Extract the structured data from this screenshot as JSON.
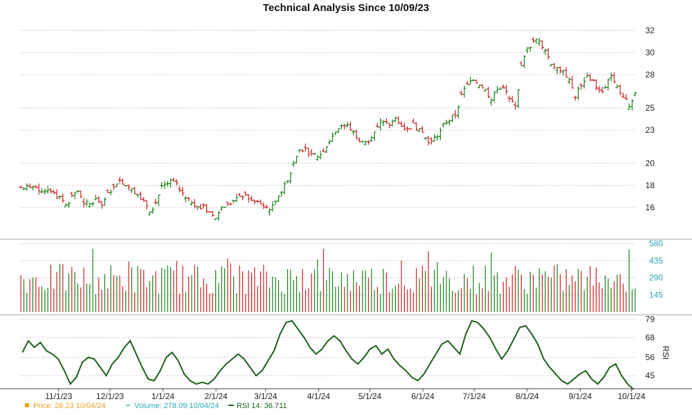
{
  "chart_data": {
    "type": "ohlc",
    "title": "Technical Analysis Since 10/09/23",
    "x_dates": [
      "2023-10-09",
      "2024-10-04"
    ],
    "x_tick_labels": [
      "11/1/23",
      "12/1/23",
      "1/1/24",
      "2/1/24",
      "3/1/24",
      "4/1/24",
      "5/1/24",
      "6/1/24",
      "7/1/24",
      "8/1/24",
      "9/1/24",
      "10/1/24"
    ],
    "price_panel": {
      "ylim": [
        13.5,
        33
      ],
      "ytick_labels": [
        "16",
        "18",
        "20",
        "23",
        "25",
        "28",
        "30",
        "32"
      ],
      "ytick_values": [
        16,
        18,
        20,
        23,
        25,
        28,
        30,
        32
      ],
      "colors": {
        "up": "#1a7f1a",
        "down": "#cc1f1f"
      },
      "closes": [
        17.8,
        17.9,
        18.0,
        17.6,
        17.7,
        17.5,
        16.8,
        16.4,
        17.0,
        17.5,
        16.2,
        16.3,
        16.7,
        16.4,
        17.2,
        17.8,
        18.7,
        18.1,
        17.9,
        17.2,
        16.4,
        15.8,
        16.5,
        17.9,
        18.2,
        18.3,
        17.6,
        17.1,
        16.6,
        16.3,
        16.0,
        15.4,
        15.0,
        15.8,
        16.2,
        16.5,
        16.8,
        17.1,
        16.6,
        16.3,
        16.1,
        16.0,
        16.4,
        17.6,
        18.6,
        20.0,
        21.2,
        21.4,
        20.6,
        20.5,
        21.2,
        22.2,
        22.9,
        23.6,
        23.4,
        22.8,
        22.1,
        21.8,
        22.4,
        23.3,
        23.9,
        23.5,
        24.0,
        23.6,
        23.0,
        23.5,
        22.9,
        22.4,
        21.9,
        22.6,
        23.4,
        23.9,
        24.4,
        26.2,
        27.0,
        27.5,
        27.2,
        26.6,
        25.7,
        26.6,
        27.0,
        25.9,
        25.0,
        28.6,
        30.2,
        30.9,
        31.2,
        30.4,
        29.0,
        28.6,
        28.2,
        27.6,
        26.1,
        27.2,
        27.7,
        27.3,
        26.5,
        26.7,
        27.9,
        26.9,
        25.7,
        25.3,
        26.23
      ],
      "price_label": "Price: 26.23  10/04/24"
    },
    "volume_panel": {
      "ylim": [
        0,
        580
      ],
      "ytick_labels": [
        "145",
        "290",
        "435",
        "580"
      ],
      "ytick_values": [
        145,
        290,
        435,
        580
      ],
      "color": "#2aa9b7",
      "volume_label": "Volume: 278.09  10/04/24"
    },
    "rsi_panel": {
      "ylim": [
        38,
        80
      ],
      "ytick_labels": [
        "45",
        "56",
        "68",
        "79"
      ],
      "ytick_values": [
        45,
        56,
        68,
        79
      ],
      "axis_label": "RSI",
      "values": [
        59,
        66,
        62,
        65,
        60,
        58,
        55,
        48,
        40,
        44,
        53,
        56,
        55,
        50,
        45,
        52,
        56,
        62,
        66,
        58,
        50,
        43,
        42,
        48,
        56,
        59,
        54,
        46,
        42,
        40,
        41,
        40,
        43,
        48,
        52,
        55,
        58,
        55,
        50,
        45,
        48,
        54,
        60,
        70,
        77,
        78,
        73,
        68,
        62,
        58,
        61,
        66,
        69,
        66,
        60,
        55,
        52,
        56,
        61,
        63,
        58,
        61,
        55,
        51,
        48,
        44,
        42,
        46,
        52,
        58,
        64,
        66,
        62,
        58,
        70,
        78,
        77,
        73,
        68,
        61,
        55,
        60,
        67,
        74,
        75,
        70,
        64,
        55,
        50,
        46,
        42,
        40,
        43,
        46,
        48,
        43,
        40,
        44,
        50,
        52,
        45,
        40,
        36.7
      ],
      "rsi_label": "RSI 14: 36.711"
    }
  },
  "legend": {
    "price_text": "Price: 26.23  10/04/24",
    "volume_text": "Volume: 278.09  10/04/24",
    "rsi_text": "RSI 14: 36.711",
    "price_color": "#f0a020",
    "volume_color": "#2aa9b7",
    "rsi_color": "#1a5f1a"
  }
}
